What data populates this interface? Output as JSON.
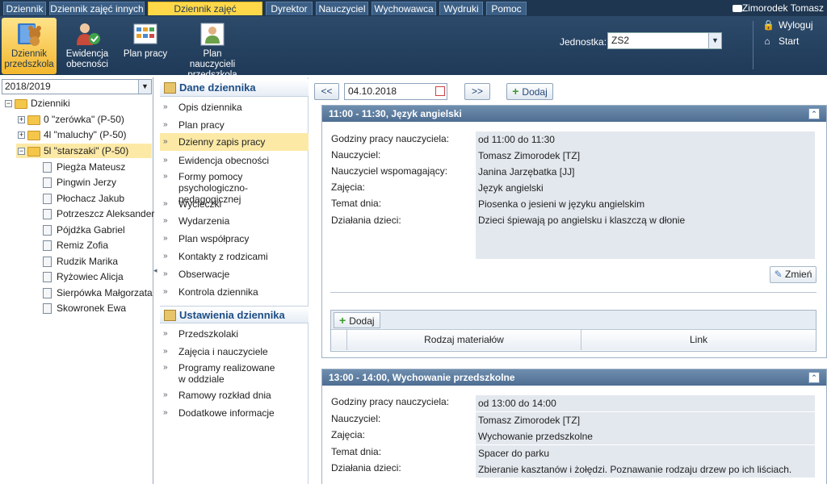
{
  "top_menu": {
    "tabs": [
      {
        "label": "Dziennik"
      },
      {
        "label": "Dziennik zajęć innych"
      },
      {
        "label": "Dziennik zajęć przedszkola"
      },
      {
        "label": "Dyrektor"
      },
      {
        "label": "Nauczyciel"
      },
      {
        "label": "Wychowawca"
      },
      {
        "label": "Wydruki"
      },
      {
        "label": "Pomoc"
      }
    ],
    "active_tab": "Dziennik zajęć przedszkola",
    "user_name": "Zimorodek Tomasz"
  },
  "toolbar": {
    "buttons": [
      {
        "label": "Dziennik przedszkola",
        "icon": "bear-book-icon"
      },
      {
        "label": "Ewidencja obecności",
        "icon": "attendance-icon"
      },
      {
        "label": "Plan pracy",
        "icon": "plan-icon"
      },
      {
        "label": "Plan nauczycieli przedszkola",
        "icon": "teacher-plan-icon"
      }
    ],
    "jednostka_label": "Jednostka:",
    "jednostka_value": "ZS2",
    "logout_label": "Wyloguj",
    "start_label": "Start"
  },
  "left_panel": {
    "year": "2018/2019",
    "root": "Dzienniki",
    "groups": [
      "0 \"zerówka\" (P-50)",
      "4l \"maluchy\" (P-50)",
      "5l \"starszaki\" (P-50)"
    ],
    "students": [
      "Piegża Mateusz",
      "Pingwin Jerzy",
      "Płochacz Jakub",
      "Potrzeszcz Aleksander",
      "Pójdźka Gabriel",
      "Remiz Zofia",
      "Rudzik Marika",
      "Ryżowiec Alicja",
      "Sierpówka Małgorzata",
      "Skowronek Ewa"
    ]
  },
  "nav": {
    "section1_title": "Dane dziennika",
    "section1_items": [
      "Opis dziennika",
      "Plan pracy",
      "Dzienny zapis pracy",
      "Ewidencja obecności",
      "Formy pomocy psychologiczno-pedagogicznej",
      "Wycieczki",
      "Wydarzenia",
      "Plan współpracy",
      "Kontakty z rodzicami",
      "Obserwacje",
      "Kontrola dziennika"
    ],
    "section2_title": "Ustawienia dziennika",
    "section2_items": [
      "Przedszkolaki",
      "Zajęcia i nauczyciele",
      "Programy realizowane w oddziale",
      "Ramowy rozkład dnia",
      "Dodatkowe informacje"
    ]
  },
  "main": {
    "prev": "<<",
    "next": ">>",
    "date": "04.10.2018",
    "add_label": "Dodaj",
    "lessons": [
      {
        "title": "11:00 - 11:30, Język angielski",
        "labels": [
          "Godziny pracy nauczyciela:",
          "Nauczyciel:",
          "Nauczyciel wspomagający:",
          "Zajęcia:",
          "Temat dnia:",
          "Działania dzieci:"
        ],
        "values": [
          "od 11:00 do 11:30",
          "Tomasz Zimorodek [TZ]",
          "Janina Jarzębatka [JJ]",
          "Język angielski",
          "Piosenka o jesieni w języku angielskim",
          "Dzieci śpiewają po angielsku i klaszczą w dłonie"
        ],
        "edit_label": "Zmień",
        "materials_add": "Dodaj",
        "materials_col1": "Rodzaj materiałów",
        "materials_col2": "Link"
      },
      {
        "title": "13:00 - 14:00, Wychowanie przedszkolne",
        "labels": [
          "Godziny pracy nauczyciela:",
          "Nauczyciel:",
          "Zajęcia:",
          "Temat dnia:",
          "Działania dzieci:"
        ],
        "values": [
          "od 13:00 do 14:00",
          "Tomasz Zimorodek [TZ]",
          "Wychowanie przedszkolne",
          "Spacer do parku",
          "Zbieranie kasztanów i żołędzi. Poznawanie rodzaju drzew po ich liściach."
        ]
      }
    ]
  }
}
